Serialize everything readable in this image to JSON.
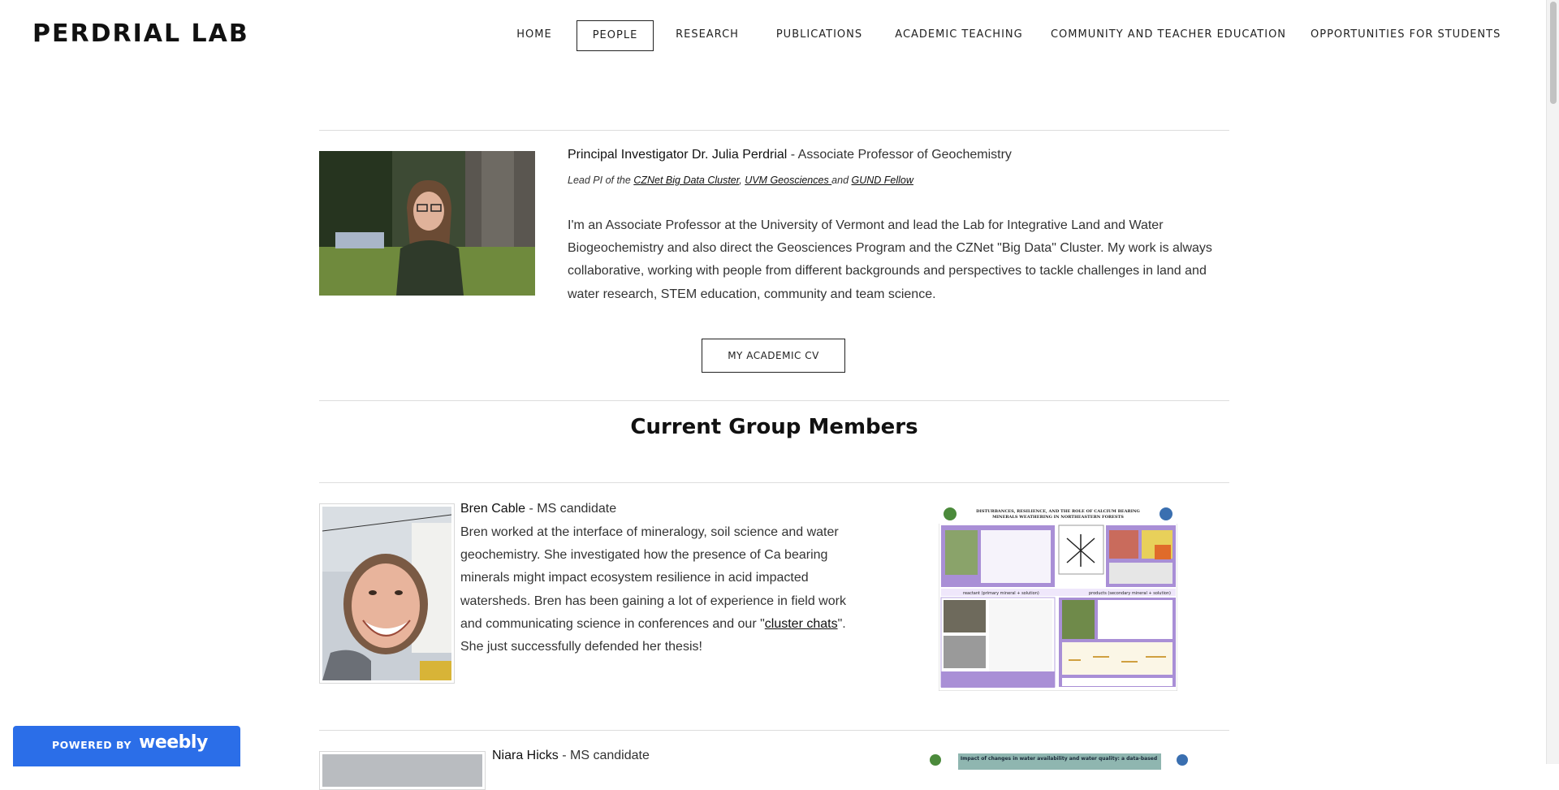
{
  "site": {
    "logo": "PERDRIAL LAB"
  },
  "nav": {
    "items": [
      {
        "label": "HOME",
        "active": false
      },
      {
        "label": "PEOPLE",
        "active": true
      },
      {
        "label": "RESEARCH",
        "active": false
      },
      {
        "label": "PUBLICATIONS",
        "active": false
      },
      {
        "label": "ACADEMIC TEACHING",
        "active": false
      },
      {
        "label": "COMMUNITY AND TEACHER EDUCATION",
        "active": false
      },
      {
        "label": "OPPORTUNITIES FOR STUDENTS",
        "active": false
      }
    ]
  },
  "pi": {
    "name": "Principal Investigator Dr. Julia Perdrial",
    "title": " - Associate Professor of Geochemistry",
    "sub_prefix": "Lead PI of the ",
    "link1": "CZNet Big Data Cluster",
    "sep1": ", ",
    "link2": "UVM Geosciences ",
    "sep2": "and ",
    "link3": "GUND Fellow",
    "bio": "I'm an Associate Professor at the University of Vermont and lead the Lab for Integrative Land and Water Biogeochemistry and also direct the Geosciences Program and the CZNet \"Big Data\" Cluster. My work is always collaborative, working with people from different backgrounds and perspectives to tackle challenges in land and water research, STEM education, community and team science.",
    "cv_button": "MY ACADEMIC CV"
  },
  "group": {
    "title": "Current Group Members"
  },
  "members": [
    {
      "name": "Bren Cable",
      "role": " - MS candidate",
      "bio_before": "Bren worked at the interface of mineralogy, soil science and water geochemistry. She investigated how the presence of Ca bearing minerals might impact ecosystem resilience in acid impacted watersheds. Bren has been gaining a lot  of experience in field work and communicating science in conferences and our \"",
      "bio_link": "cluster chats",
      "bio_after": "\". She just successfully defended her thesis!",
      "poster_title_1": "DISTURBANCES, RESILIENCE, AND THE ROLE OF CALCIUM BEARING",
      "poster_title_2": "MINERALS WEATHERING IN NORTHEASTERN FORESTS",
      "poster_reactant": "reactant (primary mineral + solution)",
      "poster_products": "products (secondary mineral + solution)"
    },
    {
      "name": "Niara Hicks",
      "role": " - MS candidate",
      "poster_title_1": "Impact of changes in water availability and water quality: a data-based"
    }
  ],
  "badge": {
    "powered": "POWERED BY",
    "brand": "weebly"
  },
  "colors": {
    "badge_bg": "#2b6ee8",
    "poster_purple": "#a98fd6",
    "text": "#333333"
  }
}
